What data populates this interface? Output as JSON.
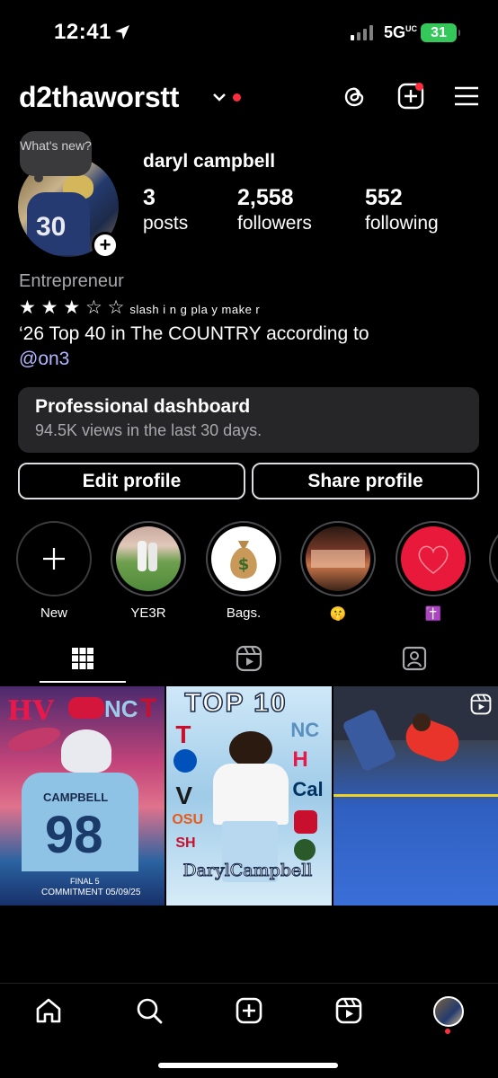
{
  "status": {
    "time": "12:41",
    "network": "5G",
    "network_sup": "UC",
    "battery": "31"
  },
  "header": {
    "username": "d2thaworstt"
  },
  "profile": {
    "note": "What's new?",
    "full_name": "daryl campbell",
    "stats": [
      {
        "value": "3",
        "label": "posts"
      },
      {
        "value": "2,558",
        "label": "followers"
      },
      {
        "value": "552",
        "label": "following"
      }
    ],
    "category": "Entrepreneur",
    "bio_stars": "★ ★ ★ ☆ ☆",
    "bio_tag": "slash i n g pla y make r",
    "bio_line2": "‘26 Top 40 in The COUNTRY according to",
    "bio_link": "@on3"
  },
  "dashboard": {
    "title": "Professional dashboard",
    "subtitle": "94.5K views in the last 30 days."
  },
  "buttons": {
    "edit": "Edit profile",
    "share": "Share profile"
  },
  "highlights": [
    {
      "label": "New"
    },
    {
      "label": "YE3R"
    },
    {
      "label": "Bags."
    },
    {
      "label": "🤫"
    },
    {
      "label": "✝️"
    }
  ],
  "posts": [
    {
      "alt_text": "CAMPBELL 98 FINAL 5 COMMITMENT 05/09/25"
    },
    {
      "alt_text": "TOP 10 DarylCampbell"
    },
    {
      "alt_text": "training drill reel"
    }
  ],
  "colors": {
    "accent_red": "#ff2d3d",
    "link": "#b3b6ff",
    "battery": "#34c759"
  }
}
